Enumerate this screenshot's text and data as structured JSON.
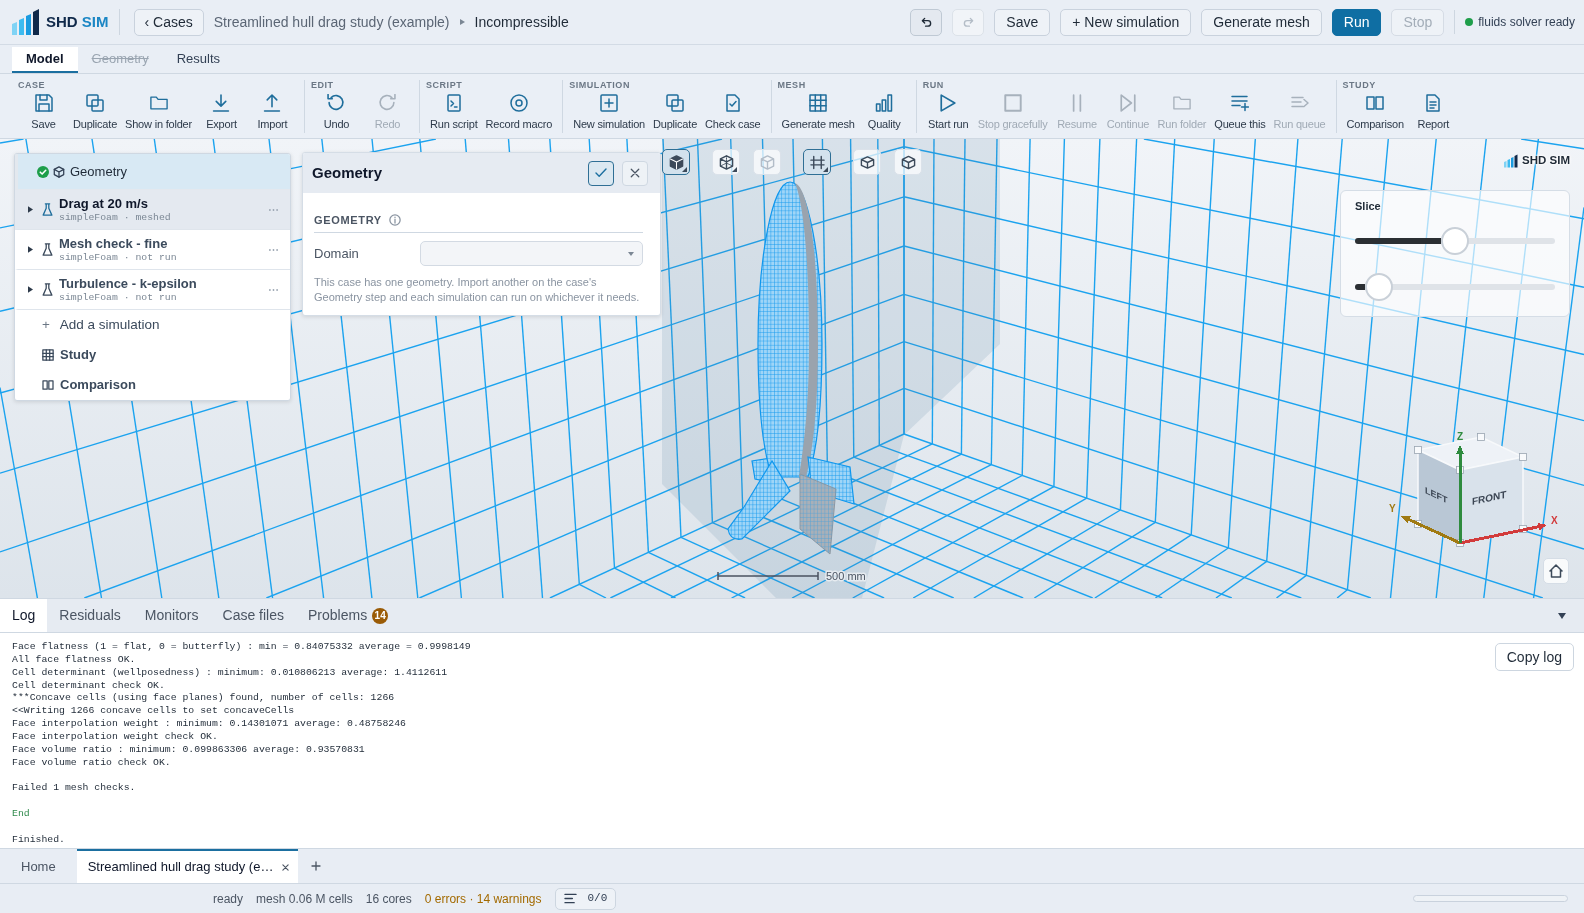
{
  "brand": {
    "name": "SHD",
    "accent": "SIM"
  },
  "header": {
    "back_button": "‹ Cases",
    "breadcrumb": [
      {
        "label": "Streamlined hull drag study (example)",
        "current": false
      },
      {
        "label": "Incompressible",
        "current": true
      }
    ],
    "buttons": [
      {
        "kind": "undo",
        "disabled": false
      },
      {
        "kind": "redo",
        "disabled": true
      },
      {
        "kind": "text",
        "label": "Save",
        "primary": false,
        "disabled": false
      },
      {
        "kind": "text",
        "label": "+ New simulation",
        "primary": false,
        "disabled": false
      },
      {
        "kind": "text",
        "label": "Generate mesh",
        "primary": false,
        "disabled": false
      },
      {
        "kind": "text",
        "label": "Run",
        "primary": true,
        "disabled": false
      },
      {
        "kind": "text",
        "label": "Stop",
        "primary": false,
        "disabled": true
      }
    ],
    "solver_status": {
      "label": "fluids solver ready",
      "ready": true
    }
  },
  "tabs": [
    {
      "label": "Model",
      "selected": true,
      "disabled": false
    },
    {
      "label": "Geometry",
      "selected": false,
      "disabled": true
    },
    {
      "label": "Results",
      "selected": false,
      "disabled": false
    }
  ],
  "ribbon": [
    {
      "title": "CASE",
      "items": [
        {
          "kind": "save",
          "label": "Save",
          "disabled": false
        },
        {
          "kind": "duplicate",
          "label": "Duplicate",
          "disabled": false
        },
        {
          "kind": "folder",
          "label": "Show in folder",
          "disabled": false
        },
        {
          "kind": "export",
          "label": "Export",
          "disabled": false
        },
        {
          "kind": "import",
          "label": "Import",
          "disabled": false
        }
      ]
    },
    {
      "title": "EDIT",
      "items": [
        {
          "kind": "undo",
          "label": "Undo",
          "disabled": false
        },
        {
          "kind": "redo",
          "label": "Redo",
          "disabled": true
        }
      ]
    },
    {
      "title": "SCRIPT",
      "items": [
        {
          "kind": "script",
          "label": "Run script",
          "disabled": false
        },
        {
          "kind": "record",
          "label": "Record macro",
          "disabled": false
        }
      ]
    },
    {
      "title": "SIMULATION",
      "items": [
        {
          "kind": "add",
          "label": "New simulation",
          "disabled": false
        },
        {
          "kind": "duplicate",
          "label": "Duplicate",
          "disabled": false
        },
        {
          "kind": "check",
          "label": "Check case",
          "disabled": false
        }
      ]
    },
    {
      "title": "MESH",
      "items": [
        {
          "kind": "mesh",
          "label": "Generate mesh",
          "disabled": false
        },
        {
          "kind": "quality",
          "label": "Quality",
          "disabled": false
        }
      ]
    },
    {
      "title": "RUN",
      "items": [
        {
          "kind": "start",
          "label": "Start run",
          "disabled": false
        },
        {
          "kind": "stop",
          "label": "Stop gracefully",
          "disabled": true
        },
        {
          "kind": "resume",
          "label": "Resume",
          "disabled": true
        },
        {
          "kind": "continue",
          "label": "Continue",
          "disabled": true
        },
        {
          "kind": "folder",
          "label": "Run folder",
          "disabled": true
        },
        {
          "kind": "queue",
          "label": "Queue this",
          "disabled": false
        },
        {
          "kind": "runqueue",
          "label": "Run queue",
          "disabled": true
        }
      ]
    },
    {
      "title": "STUDY",
      "items": [
        {
          "kind": "compare",
          "label": "Comparison",
          "disabled": false
        },
        {
          "kind": "report",
          "label": "Report",
          "disabled": false
        }
      ]
    }
  ],
  "viewport": {
    "tree": [
      {
        "kind": "geometry",
        "label": "Geometry",
        "selected": true,
        "valid": true
      },
      {
        "kind": "simulation",
        "label": "Drag at 20 m/s",
        "detail": "simpleFoam · meshed",
        "selected": false,
        "active": true,
        "expanded": false
      },
      {
        "kind": "simulation",
        "label": "Mesh check - fine",
        "detail": "simpleFoam · not run",
        "selected": false,
        "active": false,
        "expanded": false
      },
      {
        "kind": "simulation",
        "label": "Turbulence - k-epsilon",
        "detail": "simpleFoam · not run",
        "selected": false,
        "active": false,
        "expanded": false
      },
      {
        "kind": "add",
        "symbol": "+",
        "label": "Add a simulation",
        "selected": false
      },
      {
        "kind": "study",
        "label": "Study",
        "selected": false
      },
      {
        "kind": "comparison",
        "label": "Comparison",
        "selected": false
      }
    ],
    "properties": {
      "title": "Geometry",
      "section": "GEOMETRY",
      "fields": [
        {
          "label": "Domain"
        }
      ],
      "help": "This case has one geometry. Import another on the case's Geometry step and each simulation can run on whichever it needs."
    },
    "view_tools": [
      [
        {
          "kind": "shaded",
          "selected": true,
          "disabled": false,
          "menu": true
        }
      ],
      [
        {
          "kind": "wireframe",
          "selected": false,
          "disabled": false,
          "menu": true
        },
        {
          "kind": "transparent",
          "selected": false,
          "disabled": true,
          "menu": false
        }
      ],
      [
        {
          "kind": "section",
          "selected": true,
          "disabled": false,
          "menu": true
        }
      ],
      [
        {
          "kind": "box",
          "selected": false,
          "disabled": false,
          "menu": false
        },
        {
          "kind": "cube",
          "selected": false,
          "disabled": false,
          "menu": false
        }
      ]
    ],
    "logo_text": "SHD SIM",
    "slice": {
      "title": "Slice",
      "sliders": [
        {
          "level": 0.5
        },
        {
          "level": 0.12
        }
      ]
    },
    "scale_bar": "500 mm",
    "view_cube": {
      "faces": [
        {
          "label": "LEFT"
        },
        {
          "label": "FRONT"
        }
      ],
      "axes": [
        {
          "label": "X",
          "color": "#d23b3b"
        },
        {
          "label": "Y",
          "color": "#a07a12"
        },
        {
          "label": "Z",
          "color": "#2e8b3e"
        }
      ]
    }
  },
  "console": {
    "tabs": [
      {
        "label": "Log",
        "selected": true
      },
      {
        "label": "Residuals",
        "selected": false
      },
      {
        "label": "Monitors",
        "selected": false
      },
      {
        "label": "Case files",
        "selected": false
      },
      {
        "label": "Problems",
        "selected": false,
        "badge": "14"
      }
    ],
    "lines": [
      {
        "text": "Face flatness (1 = flat, 0 = butterfly) : min = 0.84075332 average = 0.9998149",
        "kind": "output"
      },
      {
        "text": "All face flatness OK.",
        "kind": "output"
      },
      {
        "text": "Cell determinant (wellposedness) : minimum: 0.010806213 average: 1.4112611",
        "kind": "output"
      },
      {
        "text": "Cell determinant check OK.",
        "kind": "output"
      },
      {
        "text": "***Concave cells (using face planes) found, number of cells: 1266",
        "kind": "output"
      },
      {
        "text": "<<Writing 1266 concave cells to set concaveCells",
        "kind": "output"
      },
      {
        "text": "Face interpolation weight : minimum: 0.14301071 average: 0.48758246",
        "kind": "output"
      },
      {
        "text": "Face interpolation weight check OK.",
        "kind": "output"
      },
      {
        "text": "Face volume ratio : minimum: 0.099863306 average: 0.93570831",
        "kind": "output"
      },
      {
        "text": "Face volume ratio check OK.",
        "kind": "output"
      },
      {
        "kind": "blank"
      },
      {
        "text": "Failed 1 mesh checks.",
        "kind": "output"
      },
      {
        "kind": "blank"
      },
      {
        "text": "End",
        "kind": "success"
      },
      {
        "kind": "blank"
      },
      {
        "text": "Finished.",
        "kind": "output"
      }
    ],
    "copy_button": "Copy log"
  },
  "documents": [
    {
      "label": "Home",
      "selected": false,
      "closable": false
    },
    {
      "label": "Streamlined hull drag study (e…",
      "selected": true,
      "closable": true
    }
  ],
  "status_bar": {
    "items": [
      {
        "text": "ready",
        "kind": "info"
      },
      {
        "text": "mesh 0.06 M cells",
        "kind": "info"
      },
      {
        "text": "16 cores",
        "kind": "info"
      },
      {
        "text": "0 errors · 14 warnings",
        "kind": "warning"
      }
    ],
    "queue_button": "0/0",
    "progress": {
      "level": 0
    }
  }
}
